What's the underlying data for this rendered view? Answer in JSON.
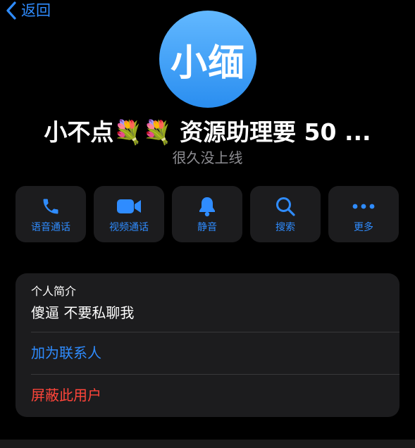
{
  "nav": {
    "back_label": "返回"
  },
  "profile": {
    "avatar_text": "小缅",
    "name": "小不点💐💐 资源助理要 50 ...",
    "status": "很久没上线"
  },
  "actions": [
    {
      "label": "语音通话",
      "icon": "phone-icon"
    },
    {
      "label": "视频通话",
      "icon": "video-camera-icon"
    },
    {
      "label": "静音",
      "icon": "bell-icon"
    },
    {
      "label": "搜索",
      "icon": "search-icon"
    },
    {
      "label": "更多",
      "icon": "ellipsis-icon"
    }
  ],
  "info": {
    "bio_title": "个人简介",
    "bio_text": "傻逼 不要私聊我",
    "add_contact": "加为联系人",
    "block_user": "屏蔽此用户"
  },
  "colors": {
    "background": "#000000",
    "card": "#1c1c1e",
    "accent": "#2f8cff",
    "danger": "#ff453a",
    "secondary_text": "#8e8e93",
    "avatar_gradient_top": "#62b8ff",
    "avatar_gradient_bottom": "#2a8ef0"
  }
}
